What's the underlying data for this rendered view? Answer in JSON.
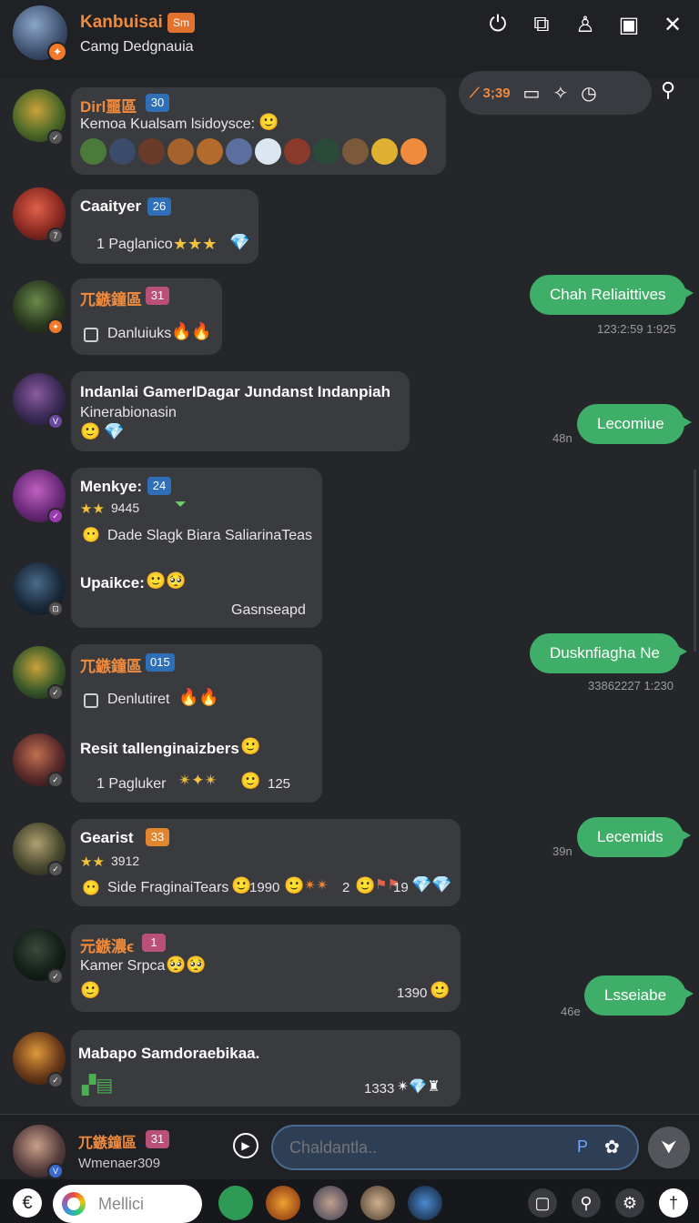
{
  "header": {
    "title": "Kanbuisai",
    "tag": "Sm",
    "subtitle": "Camg Dedgnauia",
    "icons": [
      "power-icon",
      "share-icon",
      "pin-icon",
      "calendar-icon",
      "close-icon"
    ]
  },
  "toolbar": {
    "time": "3;39",
    "icons": [
      "brush-icon",
      "screen-icon",
      "sparkle-icon",
      "clock-icon",
      "wrench-icon"
    ]
  },
  "messages": [
    {
      "name": "Dirl噩區",
      "level": "30",
      "text": "Kemoa Kualsam lsidoysce:",
      "emoji": "🙂"
    },
    {
      "name": "Caaityer",
      "level": "26",
      "text": "1 Paglanico",
      "stars": "★★★",
      "gem": "💎"
    },
    {
      "name": "兀鏃鐘區",
      "level": "31",
      "text": "Danluiuks",
      "emoji": "🔥🔥"
    },
    {
      "name": "Indanlai GamerIDagar Jundanst Indanpiah",
      "text": "Kinerabionasin",
      "emoji": "🙂",
      "gem": "💎"
    },
    {
      "name": "Menkye:",
      "level": "24",
      "stars": "★★",
      "score": "9445",
      "text": "Dade Slagk Biara SaliarinaTeas"
    },
    {
      "name": "Upaikce:",
      "emoji": "🙂🥺",
      "text": "Gasnseapd"
    },
    {
      "name": "兀鏃鐘區",
      "level": "015",
      "text": "Denlutiret",
      "emoji": "🔥🔥"
    },
    {
      "name": "Resit tallenginaizbers",
      "emoji": "🙂",
      "text": "1 Pagluker",
      "score": "125"
    },
    {
      "name": "Gearist",
      "level": "33",
      "stars": "★★",
      "score": "3912",
      "text": "Side FraginaiTears",
      "extra1": "1990",
      "extra2": "2",
      "extra3": "19"
    },
    {
      "name": "元鏃濃ϵ",
      "level": "1",
      "text": "Kamer Srpca",
      "score": "1390"
    },
    {
      "name": "Mabapo Samdoraebikaa.",
      "score": "1333"
    }
  ],
  "sent": [
    {
      "text": "Chah Reliaittives",
      "meta": "123:2:59 1:925"
    },
    {
      "text": "Lecomiue",
      "meta": "48n"
    },
    {
      "text": "Dusknfiagha Ne",
      "meta": "33862227 1:230"
    },
    {
      "text": "Lecemids",
      "meta": "39n"
    },
    {
      "text": "Lsseiabe",
      "meta": "46e"
    }
  ],
  "composer": {
    "my_name": "兀鏃鐘區",
    "my_level": "31",
    "my_sub": "Wmenaer309",
    "placeholder": "Chaldantla..",
    "p_label": "P"
  },
  "dock": {
    "search_text": "Mellici"
  },
  "colors": {
    "accent": "#f08a3c",
    "sent_bubble": "#3fae68",
    "received_bubble": "#3a3b3f",
    "background": "#25262a"
  }
}
